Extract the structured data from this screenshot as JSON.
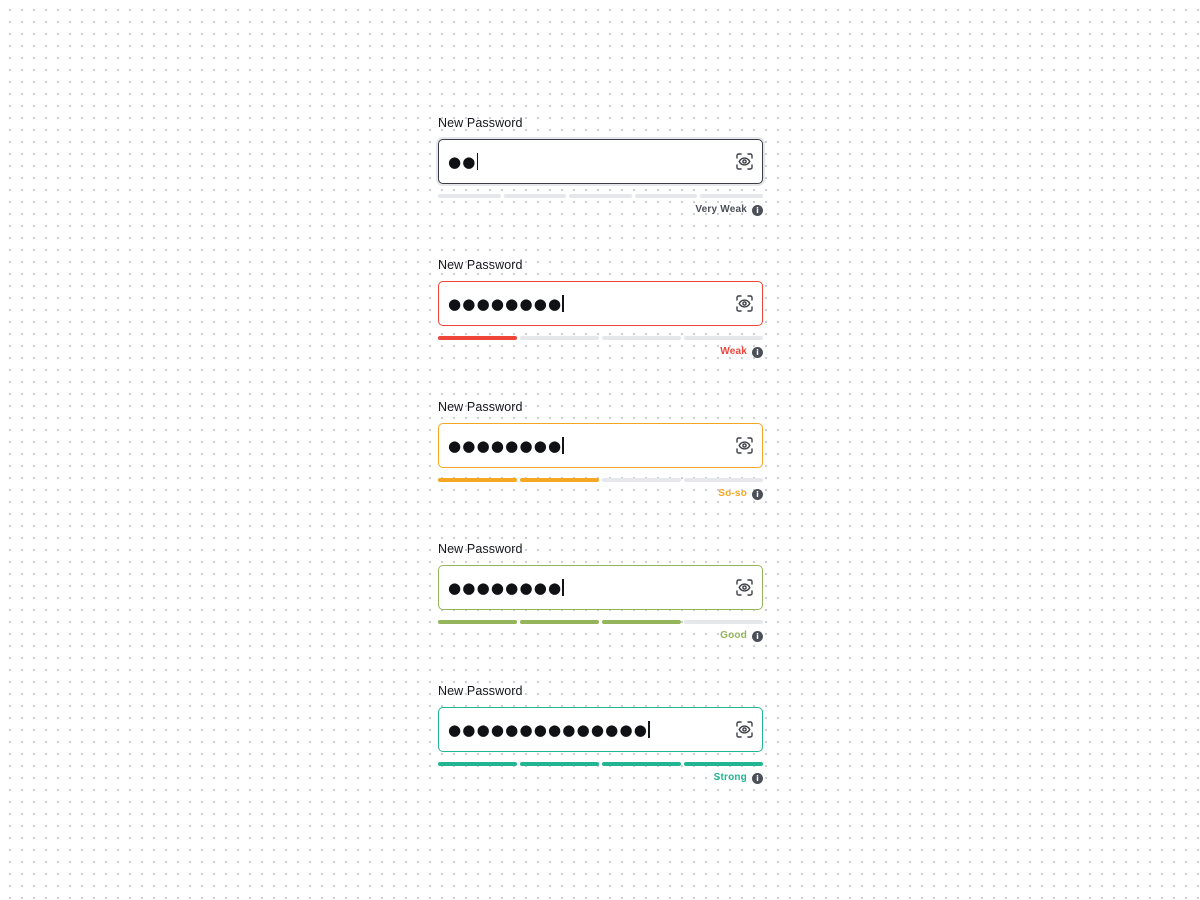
{
  "fields": [
    {
      "label": "New Password",
      "dots": "●●",
      "strength": "Very Weak",
      "strength_color": "#4b4f58",
      "border_color": "#3a3d45",
      "filled_segments": 0,
      "total_segments": 5,
      "fill_color": "#e5e7eb"
    },
    {
      "label": "New Password",
      "dots": "●●●●●●●●",
      "strength": "Weak",
      "strength_color": "#ef4438",
      "border_color": "#ef4438",
      "filled_segments": 1,
      "total_segments": 4,
      "fill_color": "#ef4438"
    },
    {
      "label": "New Password",
      "dots": "●●●●●●●●",
      "strength": "So-so",
      "strength_color": "#f5a623",
      "border_color": "#f5a623",
      "filled_segments": 2,
      "total_segments": 4,
      "fill_color": "#f5a623"
    },
    {
      "label": "New Password",
      "dots": "●●●●●●●●",
      "strength": "Good",
      "strength_color": "#94b55a",
      "border_color": "#94b55a",
      "filled_segments": 3,
      "total_segments": 4,
      "fill_color": "#94b55a"
    },
    {
      "label": "New Password",
      "dots": "●●●●●●●●●●●●●●",
      "strength": "Strong",
      "strength_color": "#22b592",
      "border_color": "#22b592",
      "filled_segments": 4,
      "total_segments": 4,
      "fill_color": "#22b592"
    }
  ],
  "icons": {
    "toggle": "eye-icon",
    "help": "info-icon",
    "help_glyph": "i"
  },
  "colors": {
    "empty_segment": "#e5e7eb",
    "focus_ring": "#e4e6eb"
  }
}
